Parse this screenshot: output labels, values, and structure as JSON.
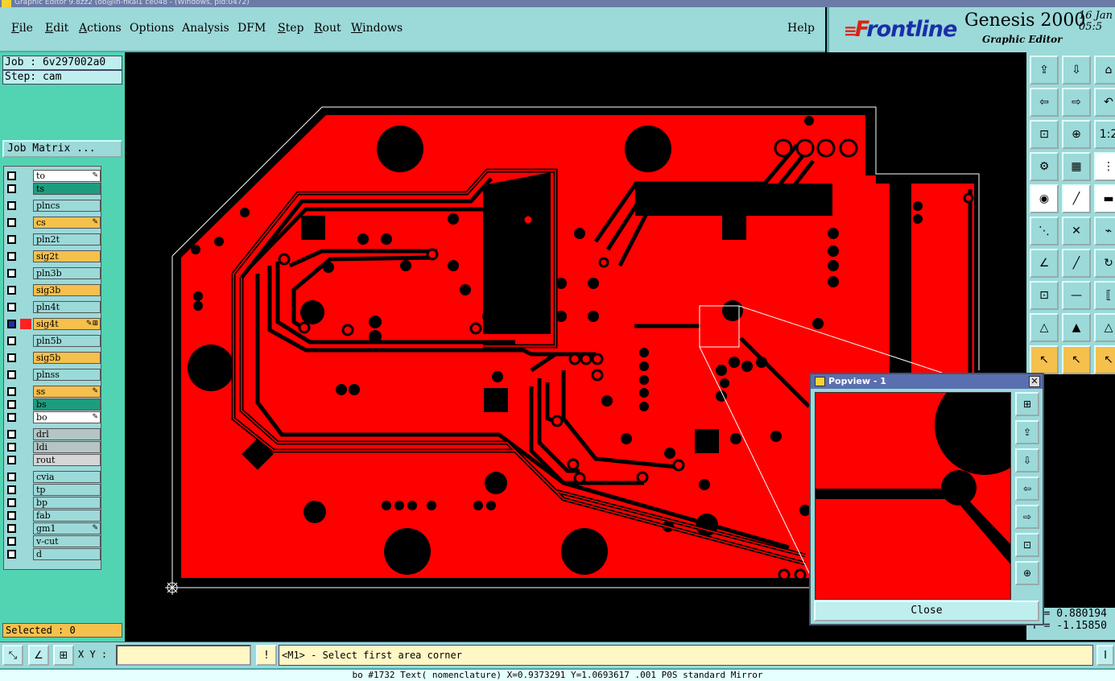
{
  "window": {
    "title": "Graphic Editor 9.8zz2 (ob@in-fikal1 ce048 - (Windows, pid:0472)"
  },
  "menu": [
    {
      "label": "File",
      "u": "F",
      "rest": "ile"
    },
    {
      "label": "Edit",
      "u": "E",
      "rest": "dit"
    },
    {
      "label": "Actions",
      "u": "A",
      "rest": "ctions"
    },
    {
      "label": "Options",
      "u": "",
      "rest": "Options"
    },
    {
      "label": "Analysis",
      "u": "",
      "rest": "Analysis"
    },
    {
      "label": "DFM",
      "u": "",
      "rest": "DFM"
    },
    {
      "label": "Step",
      "u": "S",
      "rest": "tep"
    },
    {
      "label": "Rout",
      "u": "R",
      "rest": "out"
    },
    {
      "label": "Windows",
      "u": "W",
      "rest": "indows"
    }
  ],
  "help": "Help",
  "brand": {
    "logo_f": "F",
    "logo_rest": "rontline",
    "product": "Genesis 2000",
    "subtitle": "Graphic Editor",
    "date_line1": "16 Jan",
    "date_line2": "05:5"
  },
  "job": {
    "job": "Job : 6v297002a0",
    "step": "Step: cam",
    "matrix_button": "Job Matrix ..."
  },
  "layers": [
    {
      "name": "to",
      "color": "#ffffff",
      "icon": "✎"
    },
    {
      "name": "ts",
      "color": "#1e9c7e",
      "icon": ""
    },
    {
      "name": "plncs",
      "color": "#9cd9d9",
      "icon": ""
    },
    {
      "name": "cs",
      "color": "#f5c04c",
      "icon": "✎"
    },
    {
      "name": "pln2t",
      "color": "#9cd9d9",
      "icon": ""
    },
    {
      "name": "sig2t",
      "color": "#f5c04c",
      "icon": ""
    },
    {
      "name": "pln3b",
      "color": "#9cd9d9",
      "icon": ""
    },
    {
      "name": "sig3b",
      "color": "#f5c04c",
      "icon": ""
    },
    {
      "name": "pln4t",
      "color": "#9cd9d9",
      "icon": ""
    },
    {
      "name": "sig4t",
      "color": "#f5c04c",
      "icon": "✎⊞",
      "active": true
    },
    {
      "name": "pln5b",
      "color": "#9cd9d9",
      "icon": ""
    },
    {
      "name": "sig5b",
      "color": "#f5c04c",
      "icon": ""
    },
    {
      "name": "plnss",
      "color": "#9cd9d9",
      "icon": ""
    },
    {
      "name": "ss",
      "color": "#f5c04c",
      "icon": "✎"
    },
    {
      "name": "bs",
      "color": "#1e9c7e",
      "icon": ""
    },
    {
      "name": "bo",
      "color": "#ffffff",
      "icon": "✎"
    },
    {
      "name": "drl",
      "color": "#b5c4c4",
      "icon": ""
    },
    {
      "name": "ldi",
      "color": "#b5c4c4",
      "icon": ""
    },
    {
      "name": "rout",
      "color": "#d6d6d6",
      "icon": ""
    },
    {
      "name": "cvia",
      "color": "#9cd9d9",
      "icon": ""
    },
    {
      "name": "tp",
      "color": "#9cd9d9",
      "icon": ""
    },
    {
      "name": "bp",
      "color": "#9cd9d9",
      "icon": ""
    },
    {
      "name": "fab",
      "color": "#9cd9d9",
      "icon": ""
    },
    {
      "name": "gm1",
      "color": "#9cd9d9",
      "icon": "✎"
    },
    {
      "name": "v-cut",
      "color": "#9cd9d9",
      "icon": ""
    },
    {
      "name": "d",
      "color": "#9cd9d9",
      "icon": ""
    }
  ],
  "selected": "Selected : 0",
  "popview": {
    "title": "Popview - 1",
    "close_label": "Close",
    "close_x": "✕"
  },
  "coords": {
    "x": "X = 0.880194",
    "y": "Y = -1.15850"
  },
  "status": {
    "xy_label": "X Y :",
    "xy_value": "",
    "prompt": "<M1> - Select first area corner",
    "bottom": "bo #1732 Text( nomenclature) X=0.9373291 Y=1.0693617 .001 P0S standard Mirror"
  },
  "colors": {
    "board": "#ff0000",
    "copper_void": "#000000",
    "panel": "#9cd9d9",
    "layer_panel": "#52d4b2",
    "highlight": "#f5c04c"
  }
}
